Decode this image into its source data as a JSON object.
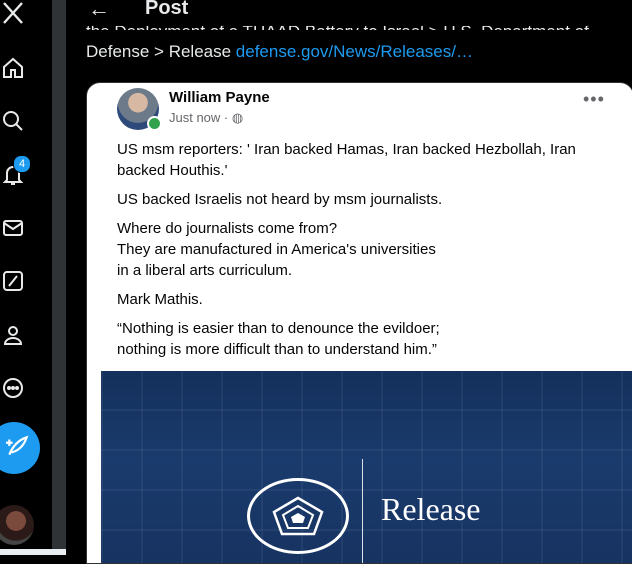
{
  "header": {
    "title": "Post",
    "back_icon": "arrow-left-icon"
  },
  "nav": {
    "items": [
      {
        "name": "x-logo-icon"
      },
      {
        "name": "home-icon"
      },
      {
        "name": "search-icon"
      },
      {
        "name": "notifications-icon"
      },
      {
        "name": "messages-icon"
      },
      {
        "name": "grok-icon"
      },
      {
        "name": "profile-icon"
      },
      {
        "name": "more-icon"
      }
    ],
    "notification_count": "4",
    "compose_icon": "feather-plus-icon"
  },
  "tweet": {
    "cut_line": "the Deployment of a THAAD Battery to Israel > U.S. Department of",
    "text_prefix": "Defense > Release ",
    "link_text": "defense.gov/News/Releases/…"
  },
  "embedded_post": {
    "author": "William Payne",
    "time": "Just now · ",
    "privacy_icon": "globe-icon",
    "paragraphs": [
      "US msm reporters: ' Iran backed Hamas,  Iran backed Hezbollah, Iran backed Houthis.'",
      "US backed Israelis not heard by msm  journalists.",
      "Where do journalists come from?\nThey are manufactured in America's universities\nin a liberal arts curriculum.",
      "Mark Mathis.",
      "“Nothing is easier than to denounce the evildoer;\nnothing is more difficult than to understand him.”"
    ]
  },
  "release_image": {
    "label": "Release"
  },
  "colors": {
    "accent": "#1d9bf0",
    "background": "#000000",
    "text": "#e7e9ea"
  }
}
